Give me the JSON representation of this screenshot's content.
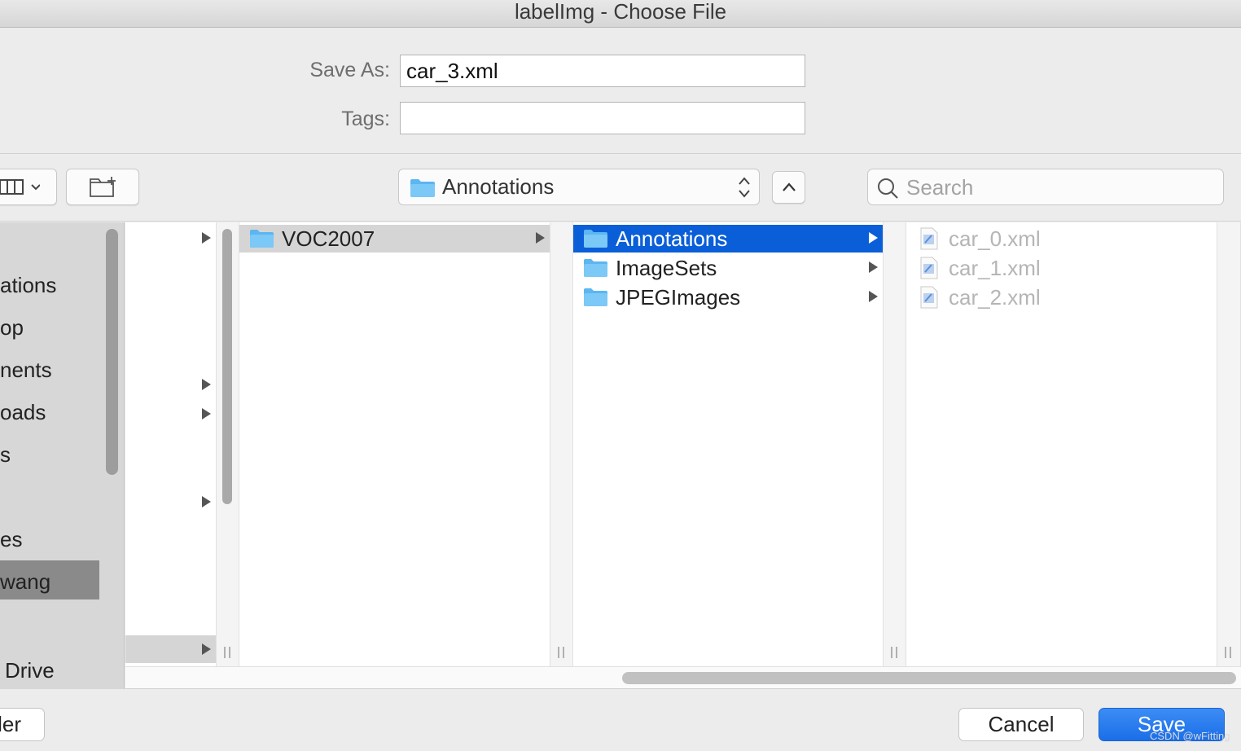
{
  "window": {
    "title": "labelImg - Choose File"
  },
  "form": {
    "save_as_label": "Save As:",
    "save_as_value": "car_3.xml",
    "tags_label": "Tags:",
    "tags_value": ""
  },
  "toolbar": {
    "location": "Annotations",
    "search_placeholder": "Search"
  },
  "sidebar": {
    "items": [
      "ations",
      "op",
      "nents",
      "oads",
      "s",
      "es",
      "wang",
      "Drive"
    ],
    "selected": "wang"
  },
  "columns": {
    "col2": [
      {
        "name": "VOC2007",
        "has_children": true,
        "state": "parent-selected"
      }
    ],
    "col3": [
      {
        "name": "Annotations",
        "has_children": true,
        "state": "selected"
      },
      {
        "name": "ImageSets",
        "has_children": true,
        "state": "normal"
      },
      {
        "name": "JPEGImages",
        "has_children": true,
        "state": "normal"
      }
    ],
    "col4": [
      {
        "name": "car_0.xml",
        "state": "disabled"
      },
      {
        "name": "car_1.xml",
        "state": "disabled"
      },
      {
        "name": "car_2.xml",
        "state": "disabled"
      }
    ]
  },
  "buttons": {
    "new_folder": "ler",
    "cancel": "Cancel",
    "save": "Save"
  },
  "watermark": "CSDN @wFitting",
  "colors": {
    "selection": "#0a5fd8",
    "primary_button": "#1a6ee8"
  }
}
